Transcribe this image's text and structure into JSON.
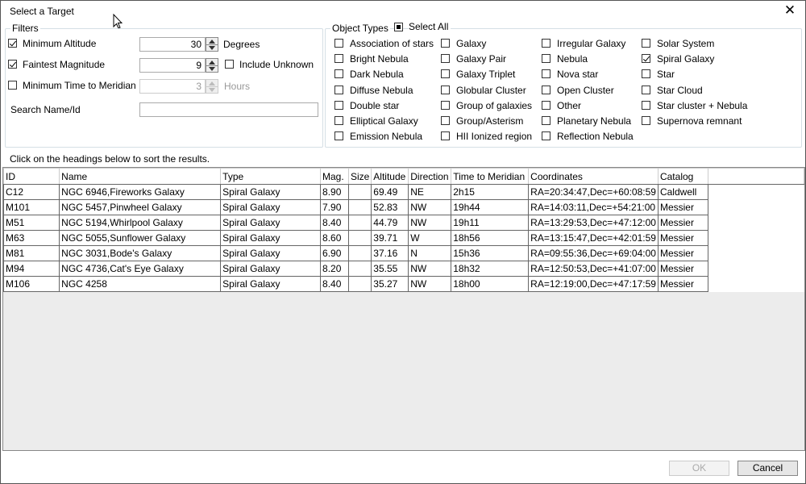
{
  "window": {
    "title": "Select a Target",
    "close_glyph": "✕"
  },
  "filters": {
    "legend": "Filters",
    "min_altitude": {
      "label": "Minimum Altitude",
      "checked": true,
      "value": "30",
      "unit": "Degrees"
    },
    "faintest_mag": {
      "label": "Faintest Magnitude",
      "checked": true,
      "value": "9",
      "include_unknown": "Include Unknown",
      "include_unknown_checked": false
    },
    "min_time": {
      "label": "Minimum Time to Meridian",
      "checked": false,
      "value": "3",
      "unit": "Hours"
    },
    "search": {
      "label": "Search Name/Id",
      "value": ""
    }
  },
  "object_types": {
    "legend": "Object Types",
    "select_all": "Select All",
    "items": [
      {
        "label": "Association of stars",
        "checked": false
      },
      {
        "label": "Bright Nebula",
        "checked": false
      },
      {
        "label": "Dark Nebula",
        "checked": false
      },
      {
        "label": "Diffuse Nebula",
        "checked": false
      },
      {
        "label": "Double star",
        "checked": false
      },
      {
        "label": "Elliptical Galaxy",
        "checked": false
      },
      {
        "label": "Emission Nebula",
        "checked": false
      },
      {
        "label": "Galaxy",
        "checked": false
      },
      {
        "label": "Galaxy Pair",
        "checked": false
      },
      {
        "label": "Galaxy Triplet",
        "checked": false
      },
      {
        "label": "Globular Cluster",
        "checked": false
      },
      {
        "label": "Group of galaxies",
        "checked": false
      },
      {
        "label": "Group/Asterism",
        "checked": false
      },
      {
        "label": "HII Ionized region",
        "checked": false
      },
      {
        "label": "Irregular Galaxy",
        "checked": false
      },
      {
        "label": "Nebula",
        "checked": false
      },
      {
        "label": "Nova star",
        "checked": false
      },
      {
        "label": "Open Cluster",
        "checked": false
      },
      {
        "label": "Other",
        "checked": false
      },
      {
        "label": "Planetary Nebula",
        "checked": false
      },
      {
        "label": "Reflection Nebula",
        "checked": false
      },
      {
        "label": "Solar System",
        "checked": false
      },
      {
        "label": "Spiral Galaxy",
        "checked": true
      },
      {
        "label": "Star",
        "checked": false
      },
      {
        "label": "Star Cloud",
        "checked": false
      },
      {
        "label": "Star cluster + Nebula",
        "checked": false
      },
      {
        "label": "Supernova remnant",
        "checked": false
      }
    ]
  },
  "hint": "Click on the headings below to sort the results.",
  "table": {
    "columns": [
      "ID",
      "Name",
      "Type",
      "Mag.",
      "Size",
      "Altitude",
      "Direction",
      "Time to Meridian",
      "Coordinates",
      "Catalog"
    ],
    "rows": [
      [
        "C12",
        "NGC 6946,Fireworks Galaxy",
        "Spiral Galaxy",
        "8.90",
        "",
        "69.49",
        "NE",
        "2h15",
        "RA=20:34:47,Dec=+60:08:59",
        "Caldwell"
      ],
      [
        "M101",
        "NGC 5457,Pinwheel Galaxy",
        "Spiral Galaxy",
        "7.90",
        "",
        "52.83",
        "NW",
        "19h44",
        "RA=14:03:11,Dec=+54:21:00",
        "Messier"
      ],
      [
        "M51",
        "NGC 5194,Whirlpool Galaxy",
        "Spiral Galaxy",
        "8.40",
        "",
        "44.79",
        "NW",
        "19h11",
        "RA=13:29:53,Dec=+47:12:00",
        "Messier"
      ],
      [
        "M63",
        "NGC 5055,Sunflower Galaxy",
        "Spiral Galaxy",
        "8.60",
        "",
        "39.71",
        "W",
        "18h56",
        "RA=13:15:47,Dec=+42:01:59",
        "Messier"
      ],
      [
        "M81",
        "NGC 3031,Bode's Galaxy",
        "Spiral Galaxy",
        "6.90",
        "",
        "37.16",
        "N",
        "15h36",
        "RA=09:55:36,Dec=+69:04:00",
        "Messier"
      ],
      [
        "M94",
        "NGC 4736,Cat's Eye Galaxy",
        "Spiral Galaxy",
        "8.20",
        "",
        "35.55",
        "NW",
        "18h32",
        "RA=12:50:53,Dec=+41:07:00",
        "Messier"
      ],
      [
        "M106",
        "NGC 4258",
        "Spiral Galaxy",
        "8.40",
        "",
        "35.27",
        "NW",
        "18h00",
        "RA=12:19:00,Dec=+47:17:59",
        "Messier"
      ]
    ]
  },
  "buttons": {
    "ok": "OK",
    "ok_enabled": false,
    "cancel": "Cancel"
  }
}
